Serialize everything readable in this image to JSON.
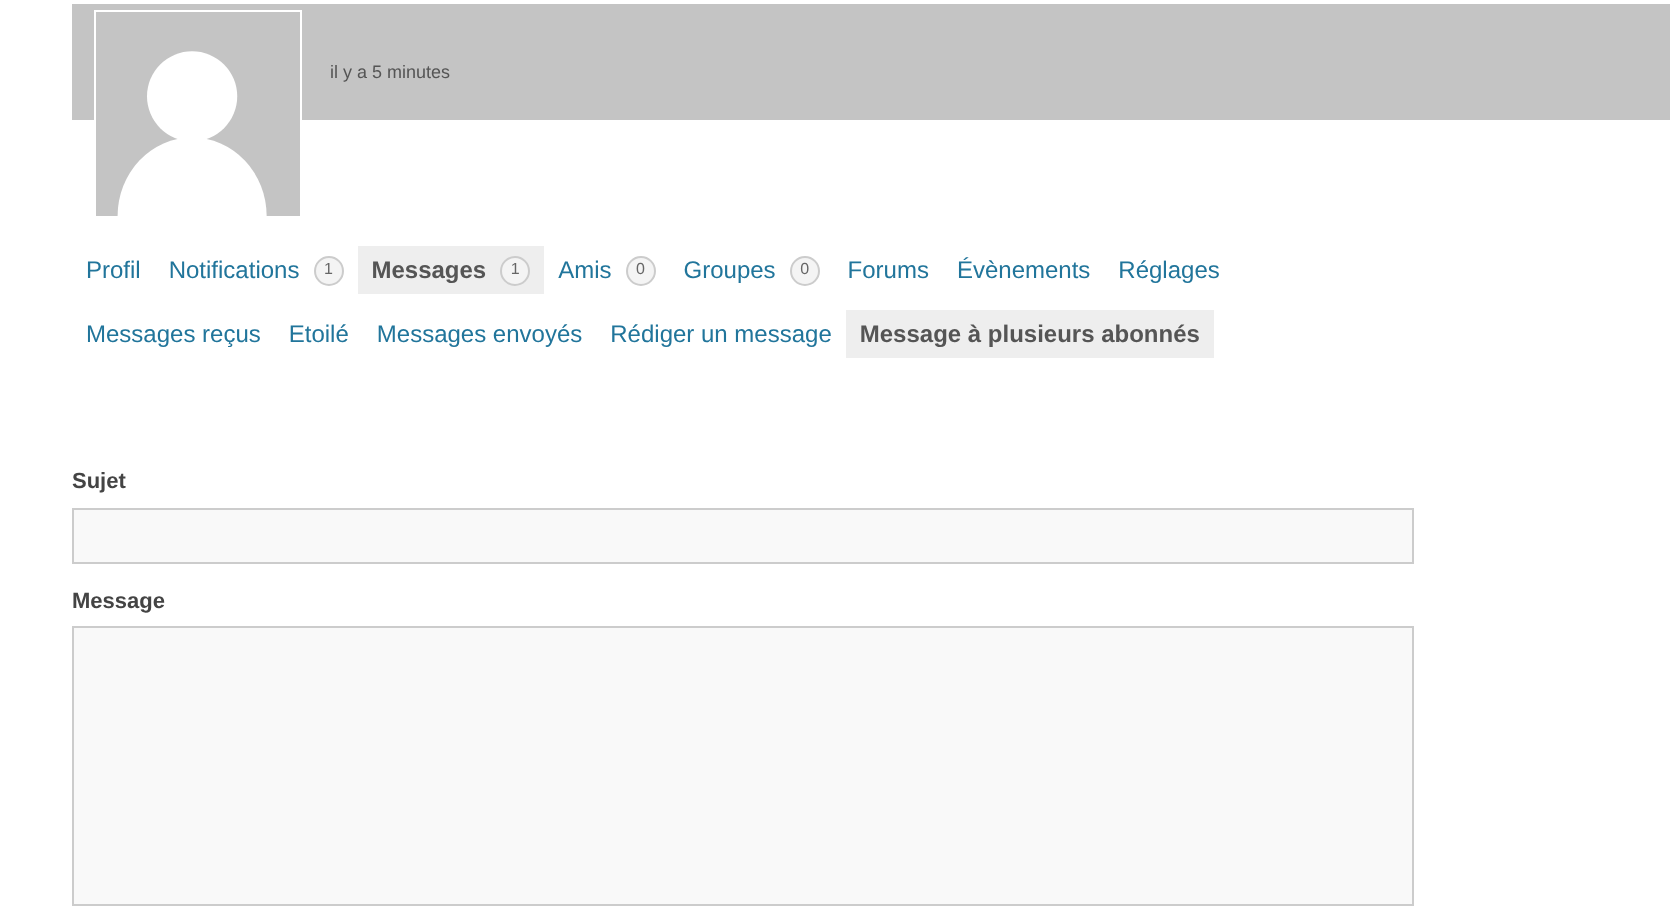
{
  "header": {
    "timestamp": "il y a 5 minutes"
  },
  "tabs": [
    {
      "label": "Profil",
      "selected": false
    },
    {
      "label": "Notifications",
      "count": "1",
      "selected": false
    },
    {
      "label": "Messages",
      "count": "1",
      "selected": true
    },
    {
      "label": "Amis",
      "count": "0",
      "selected": false
    },
    {
      "label": "Groupes",
      "count": "0",
      "selected": false
    },
    {
      "label": "Forums",
      "selected": false
    },
    {
      "label": "Évènements",
      "selected": false
    },
    {
      "label": "Réglages",
      "selected": false
    }
  ],
  "subtabs": [
    {
      "label": "Messages reçus",
      "selected": false
    },
    {
      "label": "Etoilé",
      "selected": false
    },
    {
      "label": "Messages envoyés",
      "selected": false
    },
    {
      "label": "Rédiger un message",
      "selected": false
    },
    {
      "label": "Message à plusieurs abonnés",
      "selected": true
    }
  ],
  "form": {
    "subject_label": "Sujet",
    "message_label": "Message"
  }
}
